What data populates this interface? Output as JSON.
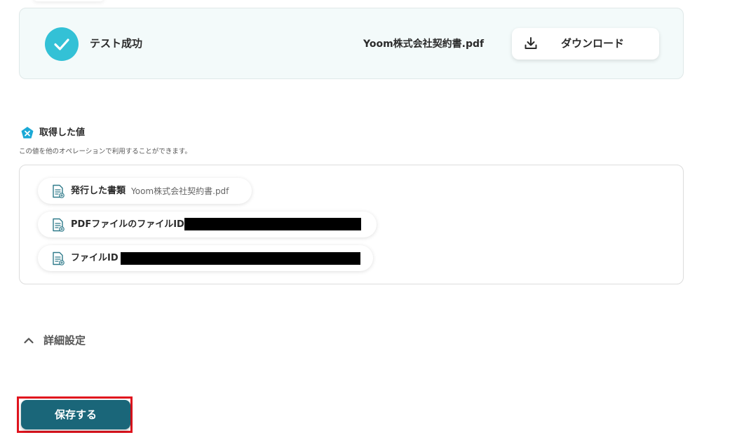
{
  "test_result": {
    "status_text": "テスト成功",
    "file_name": "Yoom株式会社契約書.pdf",
    "download_label": "ダウンロード"
  },
  "acquired_values": {
    "title": "取得した値",
    "description": "この値を他のオペレーションで利用することができます。",
    "items": [
      {
        "label": "発行した書類",
        "value": "Yoom株式会社契約書.pdf"
      },
      {
        "label": "PDFファイルのファイルID",
        "value": ""
      },
      {
        "label": "ファイルID",
        "value": ""
      }
    ]
  },
  "advanced_settings": {
    "label": "詳細設定"
  },
  "save_button": {
    "label": "保存する"
  },
  "colors": {
    "success": "#33c1d6",
    "primary_button": "#1a6679",
    "highlight": "#e0141e",
    "card_bg": "#f3fafa"
  }
}
